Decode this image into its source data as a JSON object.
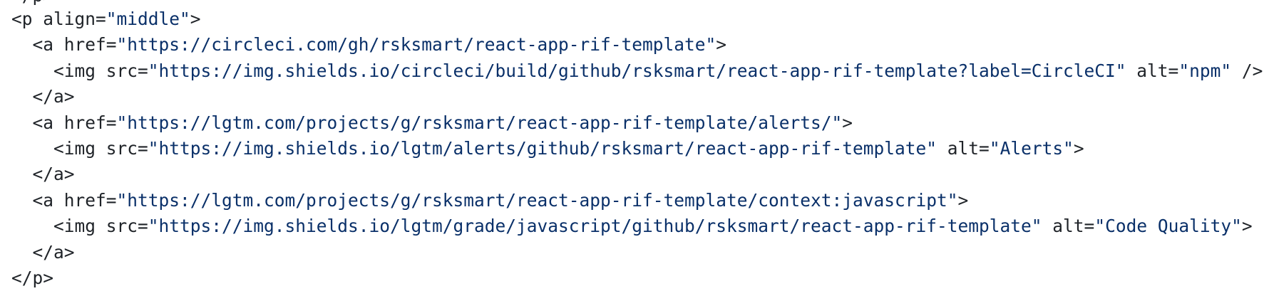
{
  "code": {
    "partial_top": "</p>",
    "lines": [
      {
        "pre": "<p align=",
        "str": "\"middle\"",
        "post": ">"
      },
      {
        "pre": "  <a href=",
        "str": "\"https://circleci.com/gh/rsksmart/react-app-rif-template\"",
        "post": ">"
      },
      {
        "pre": "    <img src=",
        "str": "\"https://img.shields.io/circleci/build/github/rsksmart/react-app-rif-template?label=CircleCI\"",
        "mid": " alt=",
        "str2": "\"npm\"",
        "post": " />"
      },
      {
        "pre": "  </a>"
      },
      {
        "pre": "  <a href=",
        "str": "\"https://lgtm.com/projects/g/rsksmart/react-app-rif-template/alerts/\"",
        "post": ">"
      },
      {
        "pre": "    <img src=",
        "str": "\"https://img.shields.io/lgtm/alerts/github/rsksmart/react-app-rif-template\"",
        "mid": " alt=",
        "str2": "\"Alerts\"",
        "post": ">"
      },
      {
        "pre": "  </a>"
      },
      {
        "pre": "  <a href=",
        "str": "\"https://lgtm.com/projects/g/rsksmart/react-app-rif-template/context:javascript\"",
        "post": ">"
      },
      {
        "pre": "    <img src=",
        "str": "\"https://img.shields.io/lgtm/grade/javascript/github/rsksmart/react-app-rif-template\"",
        "mid": " alt=",
        "str2": "\"Code Quality\"",
        "post": ">"
      },
      {
        "pre": "  </a>"
      },
      {
        "pre": "</p>"
      }
    ]
  }
}
